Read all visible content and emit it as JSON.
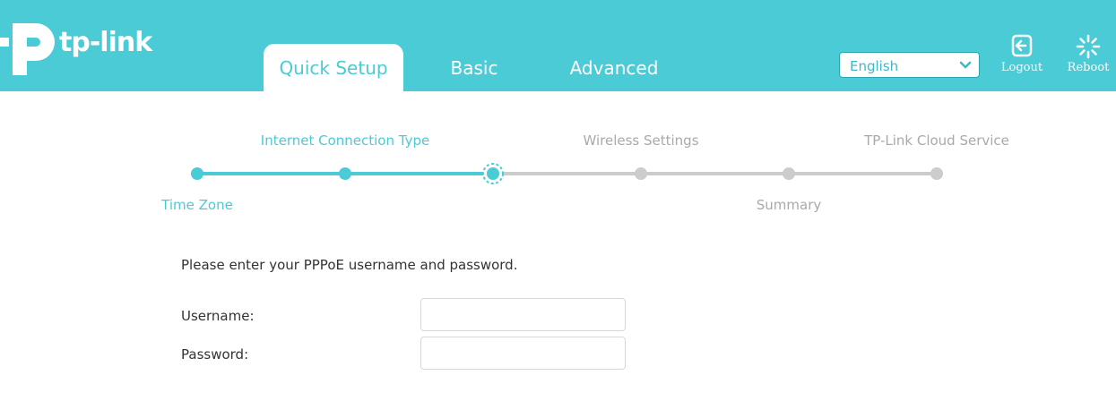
{
  "brand": {
    "name": "tp-link"
  },
  "colors": {
    "accent": "#4acbd6",
    "pending": "#cccccc",
    "text": "#333333"
  },
  "nav": {
    "tabs": [
      {
        "label": "Quick Setup",
        "active": true
      },
      {
        "label": "Basic",
        "active": false
      },
      {
        "label": "Advanced",
        "active": false
      }
    ]
  },
  "header": {
    "language": "English",
    "logout_label": "Logout",
    "reboot_label": "Reboot"
  },
  "wizard": {
    "steps": [
      {
        "label": "Time Zone",
        "status": "done"
      },
      {
        "label": "Internet Connection Type",
        "status": "done"
      },
      {
        "label": "",
        "status": "current"
      },
      {
        "label": "Wireless Settings",
        "status": "pending"
      },
      {
        "label": "Summary",
        "status": "pending"
      },
      {
        "label": "TP-Link Cloud Service",
        "status": "pending"
      }
    ]
  },
  "form": {
    "intro": "Please enter your PPPoE username and password.",
    "username_label": "Username:",
    "username_value": "",
    "password_label": "Password:",
    "password_value": ""
  }
}
